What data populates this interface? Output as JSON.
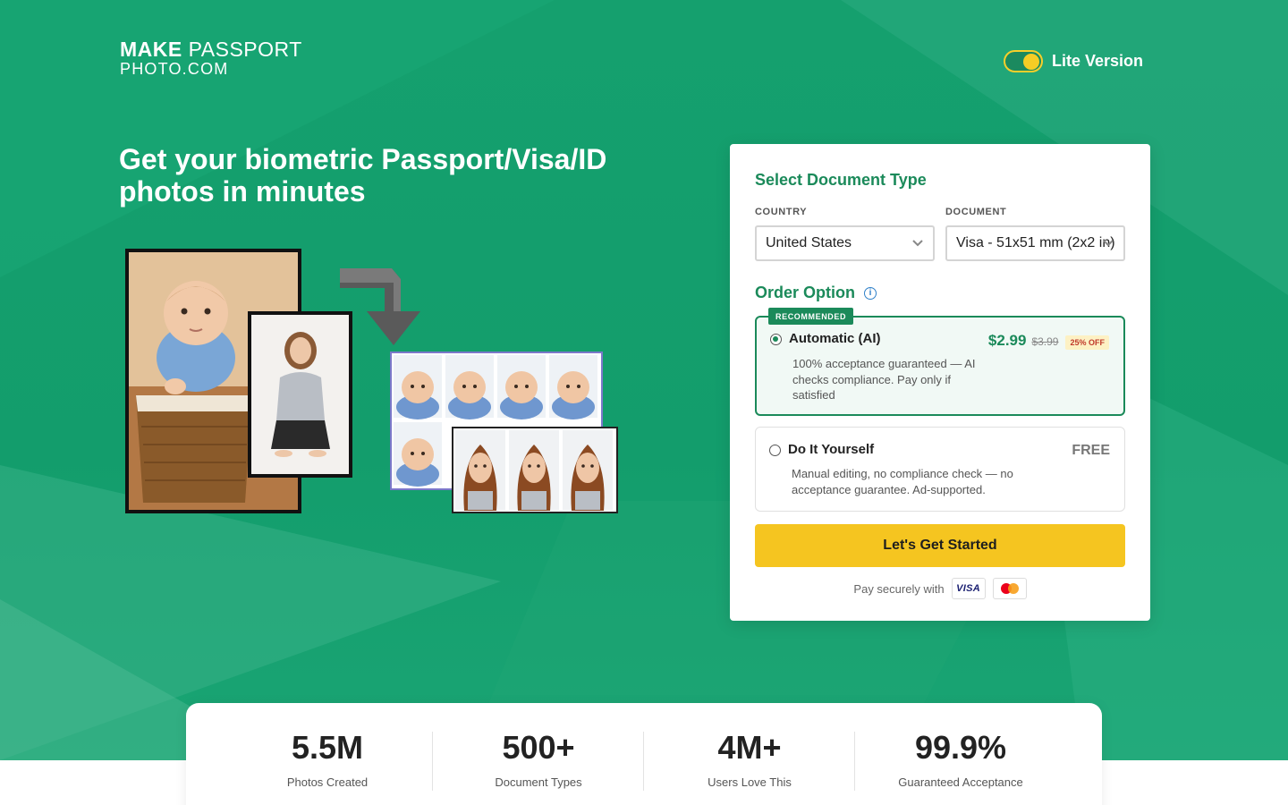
{
  "header": {
    "logo_line1_bold": "MAKE",
    "logo_line1_regular": "PASSPORT",
    "logo_line2": "PHOTO.COM",
    "lite_version_label": "Lite Version",
    "lite_version_on": true
  },
  "hero": {
    "headline": "Get your biometric Passport/Visa/ID photos in minutes"
  },
  "form": {
    "title": "Select Document Type",
    "country_label": "COUNTRY",
    "country_value": "United States",
    "document_label": "DOCUMENT",
    "document_value": "Visa - 51x51 mm (2x2 in)",
    "order_option_title": "Order Option",
    "options": [
      {
        "badge": "RECOMMENDED",
        "name": "Automatic (AI)",
        "price": "$2.99",
        "old_price": "$3.99",
        "discount": "25% OFF",
        "description": "100% acceptance guaranteed — AI checks compliance. Pay only if satisfied",
        "selected": true
      },
      {
        "name": "Do It Yourself",
        "price": "FREE",
        "description": "Manual editing, no compliance check — no acceptance guarantee. Ad-supported.",
        "selected": false
      }
    ],
    "cta_label": "Let's Get Started",
    "pay_label": "Pay securely with",
    "visa_label": "VISA"
  },
  "stats": [
    {
      "value": "5.5M",
      "label": "Photos Created"
    },
    {
      "value": "500+",
      "label": "Document Types"
    },
    {
      "value": "4M+",
      "label": "Users Love This"
    },
    {
      "value": "99.9%",
      "label": "Guaranteed Acceptance"
    }
  ],
  "colors": {
    "hero_green": "#139d6c",
    "brand_green": "#1b8a5a",
    "cta_yellow": "#f5c520",
    "toggle_yellow": "#f5cd25"
  }
}
